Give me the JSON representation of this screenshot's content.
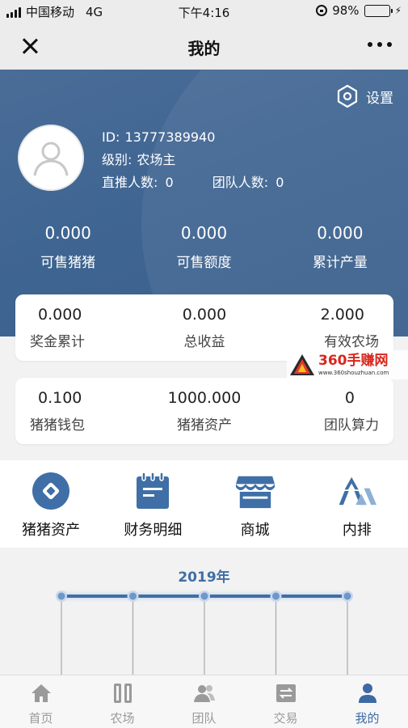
{
  "status_bar": {
    "carrier": "中国移动",
    "network": "4G",
    "time": "下午4:16",
    "battery_text": "98%"
  },
  "nav": {
    "title": "我的"
  },
  "profile": {
    "settings_label": "设置",
    "id_label": "ID:",
    "id_value": "13777389940",
    "level_label": "级别:",
    "level_value": "农场主",
    "direct_label": "直推人数:",
    "direct_value": "0",
    "team_label": "团队人数:",
    "team_value": "0"
  },
  "top_stats": [
    {
      "value": "0.000",
      "label": "可售猪猪"
    },
    {
      "value": "0.000",
      "label": "可售额度"
    },
    {
      "value": "0.000",
      "label": "累计产量"
    }
  ],
  "card1": [
    {
      "value": "0.000",
      "label": "奖金累计"
    },
    {
      "value": "0.000",
      "label": "总收益"
    },
    {
      "value": "2.000",
      "label": "有效农场"
    }
  ],
  "card2": [
    {
      "value": "0.100",
      "label": "猪猪钱包"
    },
    {
      "value": "1000.000",
      "label": "猪猪资产"
    },
    {
      "value": "0",
      "label": "团队算力"
    }
  ],
  "watermark": {
    "main": "360手赚网",
    "sub": "www.360shouzhuan.com"
  },
  "quick_menu": [
    {
      "label": "猪猪资产",
      "icon": "asset-icon"
    },
    {
      "label": "财务明细",
      "icon": "notepad-icon"
    },
    {
      "label": "商城",
      "icon": "store-icon"
    },
    {
      "label": "内排",
      "icon": "mountain-icon"
    }
  ],
  "timeline": {
    "year": "2019年",
    "node_count": 5
  },
  "tabs": [
    {
      "label": "首页",
      "icon": "home-icon",
      "active": false
    },
    {
      "label": "农场",
      "icon": "farm-icon",
      "active": false
    },
    {
      "label": "团队",
      "icon": "team-icon",
      "active": false
    },
    {
      "label": "交易",
      "icon": "exchange-icon",
      "active": false
    },
    {
      "label": "我的",
      "icon": "user-icon",
      "active": true
    }
  ],
  "colors": {
    "primary": "#3f6592",
    "accent_blue": "#3d6aa3",
    "watermark_red": "#d9261c"
  }
}
